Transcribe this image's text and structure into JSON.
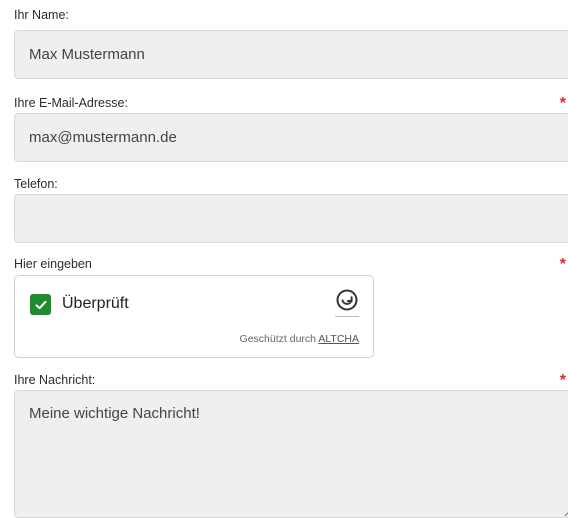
{
  "form": {
    "name": {
      "label": "Ihr Name:",
      "value": "Max Mustermann",
      "required": false
    },
    "email": {
      "label": "Ihre E-Mail-Adresse:",
      "value": "max@mustermann.de",
      "required": true
    },
    "phone": {
      "label": "Telefon:",
      "value": "",
      "required": false
    },
    "captcha": {
      "label": "Hier eingeben",
      "required": true,
      "status_label": "Überprüft",
      "checked": true,
      "protected_by": "Geschützt durch",
      "provider": "ALTCHA"
    },
    "message": {
      "label": "Ihre Nachricht:",
      "value": "Meine wichtige Nachricht!",
      "required": true
    },
    "required_marker": "*"
  },
  "colors": {
    "required": "#e5262b",
    "checkbox": "#1f8a30",
    "field_bg": "#efefef"
  },
  "icons": {
    "check": "checkmark-icon",
    "altcha_logo": "altcha-refresh-icon"
  }
}
